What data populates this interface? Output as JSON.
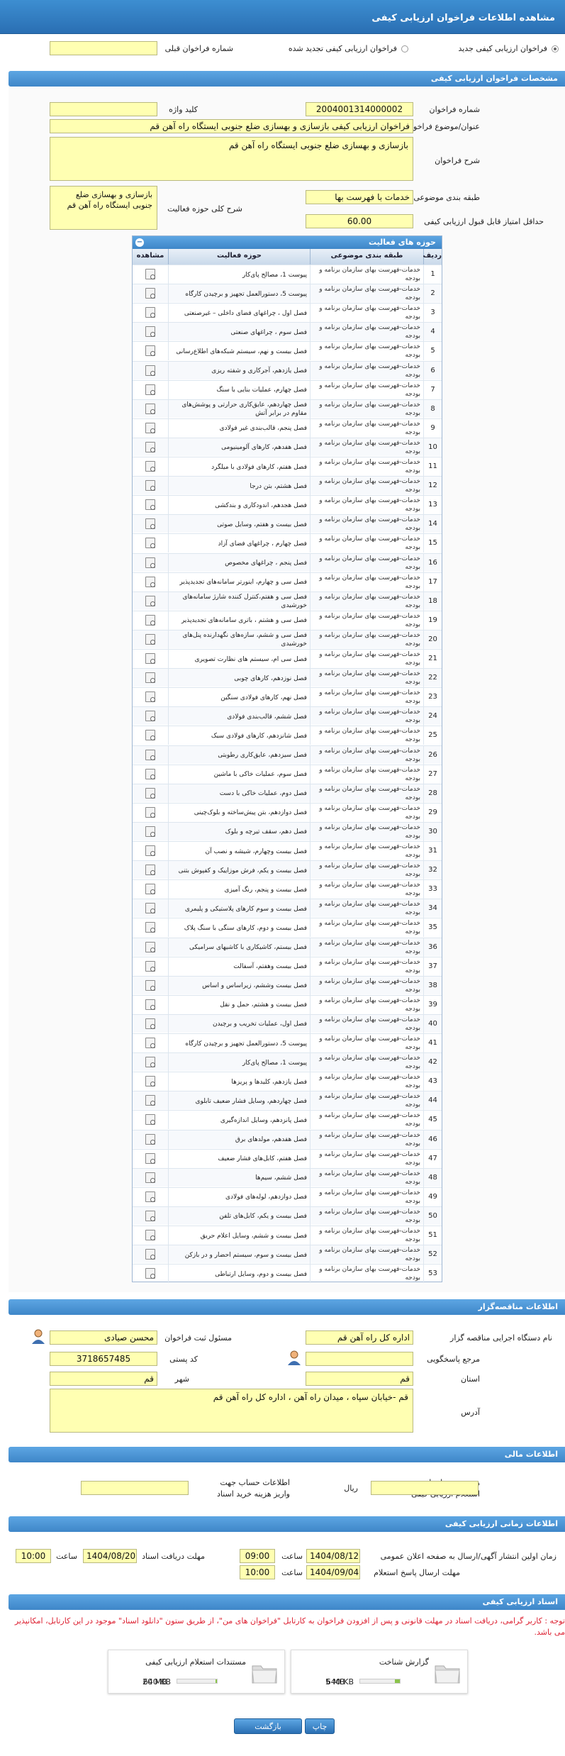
{
  "title": "مشاهده اطلاعات فراخوان ارزیابی کیفی",
  "radios": {
    "new_label": "فراخوان ارزیابی کیفی جدید",
    "renewed_label": "فراخوان ارزیابی کیفی تجدید شده",
    "previous_label": "شماره فراخوان قبلی",
    "previous_value": ""
  },
  "specs": {
    "section_title": "مشخصات فراخوان ارزیابی کیفی",
    "number_label": "شماره فراخوان",
    "number_value": "2004001314000002",
    "keyword_label": "کلید واژه",
    "keyword_value": "",
    "subject_label": "عنوان/موضوع فراخوان",
    "subject_value": "فراخوان ارزیابی کیفی بازسازی و بهسازی ضلع جنوبی ایستگاه راه آهن قم",
    "desc_label": "شرح فراخوان",
    "desc_value": "بازسازی و بهسازی ضلع جنوبی ایستگاه راه آهن قم",
    "category_label": "طبقه بندی موضوعی",
    "category_value": "خدمات با فهرست بها",
    "scope_label": "شرح کلی حوزه فعالیت",
    "scope_value": "بازسازی و بهسازی ضلع جنوبی ایستگاه راه آهن قم",
    "min_score_label": "حداقل امتیاز قابل قبول ارزیابی کیفی",
    "min_score_value": "60.00"
  },
  "activity_table": {
    "title": "حوزه های فعالیت",
    "headers": {
      "num": "ردیف",
      "category": "طبقه بندی موضوعی",
      "activity": "حوزه فعالیت",
      "view": "مشاهده"
    },
    "category_text": "خدمات-فهرست بهای سازمان برنامه و بودجه",
    "rows": [
      {
        "n": "1",
        "a": "پیوست 1، مصالح پای‌کار"
      },
      {
        "n": "2",
        "a": "پیوست 5، دستورالعمل تجهیز و برچیدن کارگاه"
      },
      {
        "n": "3",
        "a": "فصل اول ، چراغهای فضای داخلی – غیرصنعتی"
      },
      {
        "n": "4",
        "a": "فصل سوم ، چراغهای صنعتی"
      },
      {
        "n": "5",
        "a": "فصل بیست و نهم، سیستم شبکه‌های اطلاع‌رسانی"
      },
      {
        "n": "6",
        "a": "فصل یازدهم، آجرکاری و شفته ریزی"
      },
      {
        "n": "7",
        "a": "فصل چهارم، عملیات بنایی با سنگ"
      },
      {
        "n": "8",
        "a": "فصل چهاردهم، عایق‌کاری حرارتی و پوشش‌های مقاوم در برابر آتش"
      },
      {
        "n": "9",
        "a": "فصل پنجم، قالب‌بندی غیر فولادی"
      },
      {
        "n": "10",
        "a": "فصل هفدهم، کارهای آلومینیومی"
      },
      {
        "n": "11",
        "a": "فصل هفتم، کارهای فولادی با میلگرد"
      },
      {
        "n": "12",
        "a": "فصل هشتم، بتن درجا"
      },
      {
        "n": "13",
        "a": "فصل هجدهم، اندودکاری و بندکشی"
      },
      {
        "n": "14",
        "a": "فصل بیست و هفتم، وسایل صوتی"
      },
      {
        "n": "15",
        "a": "فصل چهارم ، چراغهای فضای آزاد"
      },
      {
        "n": "16",
        "a": "فصل پنجم ، چراغهای مخصوص"
      },
      {
        "n": "17",
        "a": "فصل سی و چهارم، اینورتر سامانه‌های تجدیدپذیر"
      },
      {
        "n": "18",
        "a": "فصل سی و هفتم،کنترل کننده شارژ سامانه‌های خورشیدی"
      },
      {
        "n": "19",
        "a": "فصل سی و هشتم ، باتری سامانه‌های تجدیدپذیر"
      },
      {
        "n": "20",
        "a": "فصل سی و ششم، سازه‌های نگهدارنده پنل‌های خورشیدی"
      },
      {
        "n": "21",
        "a": "فصل سی ام، سیستم های نظارت تصویری"
      },
      {
        "n": "22",
        "a": "فصل نوزدهم، کارهای چوبی"
      },
      {
        "n": "23",
        "a": "فصل نهم، کارهای فولادی سنگین"
      },
      {
        "n": "24",
        "a": "فصل ششم، قالب‌بندی فولادی"
      },
      {
        "n": "25",
        "a": "فصل شانزدهم، کارهای فولادی سبک"
      },
      {
        "n": "26",
        "a": "فصل سیزدهم، عایق‌کاری رطوبتی"
      },
      {
        "n": "27",
        "a": "فصل سوم، عملیات خاکی با ماشین"
      },
      {
        "n": "28",
        "a": "فصل دوم، عملیات خاکی با دست"
      },
      {
        "n": "29",
        "a": "فصل دوازدهم، بتن پیش‌ساخته و بلوک‌چینی"
      },
      {
        "n": "30",
        "a": "فصل دهم، سقف تیرچه و بلوک"
      },
      {
        "n": "31",
        "a": "فصل بیست وچهارم، شیشه و نصب آن"
      },
      {
        "n": "32",
        "a": "فصل بیست و یکم، فرش موزاییک و کفپوش بتنی"
      },
      {
        "n": "33",
        "a": "فصل بیست و پنجم، رنگ آمیزی"
      },
      {
        "n": "34",
        "a": "فصل بیست و سوم کارهای پلاستیکی و پلیمری"
      },
      {
        "n": "35",
        "a": "فصل بیست و دوم، کارهای سنگی با سنگ پلاک"
      },
      {
        "n": "36",
        "a": "فصل بیستم، کاشیکاری با کاشیهای سرامیکی"
      },
      {
        "n": "37",
        "a": "فصل بیست وهفتم، آسفالت"
      },
      {
        "n": "38",
        "a": "فصل بیست وششم، زیراساس و اساس"
      },
      {
        "n": "39",
        "a": "فصل بیست و هشتم، حمل و نقل"
      },
      {
        "n": "40",
        "a": "فصل اول، عملیات تخریب و برچیدن"
      },
      {
        "n": "41",
        "a": "پیوست 5، دستورالعمل تجهیز و برچیدن کارگاه"
      },
      {
        "n": "42",
        "a": "پیوست 1، مصالح پای‌کار"
      },
      {
        "n": "43",
        "a": "فصل یازدهم، کلیدها و پریزها"
      },
      {
        "n": "44",
        "a": "فصل چهاردهم، وسایل فشار ضعیف تابلوی"
      },
      {
        "n": "45",
        "a": "فصل پانزدهم، وسایل اندازه‌گیری"
      },
      {
        "n": "46",
        "a": "فصل هفدهم، مولدهای برق"
      },
      {
        "n": "47",
        "a": "فصل هفتم، کابل‌های فشار ضعیف"
      },
      {
        "n": "48",
        "a": "فصل ششم، سیم‌ها"
      },
      {
        "n": "49",
        "a": "فصل دوازدهم، لوله‌های فولادی"
      },
      {
        "n": "50",
        "a": "فصل بیست و یکم، کابل‌های تلفن"
      },
      {
        "n": "51",
        "a": "فصل بیست و ششم، وسایل اعلام حریق"
      },
      {
        "n": "52",
        "a": "فصل بیست و سوم، سیستم احضار و در بازکن"
      },
      {
        "n": "53",
        "a": "فصل بیست و دوم، وسایل ارتباطی"
      }
    ]
  },
  "organizer": {
    "section_title": "اطلاعات مناقصه‌گزار",
    "org_label": "نام دستگاه اجرایی مناقصه گزار",
    "org_value": "اداره کل راه آهن قم",
    "responsible_label": "مسئول ثبت فراخوان",
    "responsible_value": "محسن صیادی",
    "ref_label": "مرجع پاسخگویی",
    "ref_value": "",
    "postal_label": "کد پستی",
    "postal_value": "3718657485",
    "province_label": "استان",
    "province_value": "قم",
    "city_label": "شهر",
    "city_value": "قم",
    "address_label": "آدرس",
    "address_value": "قم -خیابان سپاه ، میدان راه آهن ، اداره کل راه آهن قم"
  },
  "financial": {
    "section_title": "اطلاعات مالی",
    "fee_label_1": "هزینه خرید اسناد",
    "fee_label_2": "استعلام ارزیابی کیفی",
    "fee_value": "",
    "rial": "ریال",
    "account_label_1": "اطلاعات حساب جهت",
    "account_label_2": "واریز هزینه خرید اسناد",
    "account_value": ""
  },
  "timing": {
    "section_title": "اطلاعات زمانی ارزیابی کیفی",
    "publish_label": "زمان اولین انتشار آگهی/ارسال به صفحه اعلان عمومی",
    "publish_date": "1404/08/12",
    "time_label": "ساعت",
    "publish_time": "09:00",
    "receive_label": "مهلت دریافت اسناد",
    "receive_date": "1404/08/20",
    "receive_time": "10:00",
    "reply_label": "مهلت ارسال پاسخ استعلام",
    "reply_date": "1404/09/04",
    "reply_time": "10:00"
  },
  "documents": {
    "section_title": "اسناد ارزیابی کیفی",
    "notice": "توجه : کاربر گرامی، دریافت اسناد در مهلت قانونی و پس از افزودن فراخوان به کارتابل \"فراخوان های من\"، از طریق ستون \"دانلود اسناد\" موجود در این کارتابل، امکانپذیر می باشد.",
    "files": [
      {
        "name": "گزارش شناخت",
        "size": "640 KB",
        "max": "5 MB",
        "fill": 0.13
      },
      {
        "name": "مستندات استعلام ارزیابی کیفی",
        "size": "640 KB",
        "max": "20 MB",
        "fill": 0.03
      }
    ]
  },
  "buttons": {
    "print": "چاپ",
    "back": "بازگشت"
  },
  "colors": {
    "accent": "#2a6fb3",
    "field": "#ffffb2",
    "notice": "#dd2233"
  }
}
